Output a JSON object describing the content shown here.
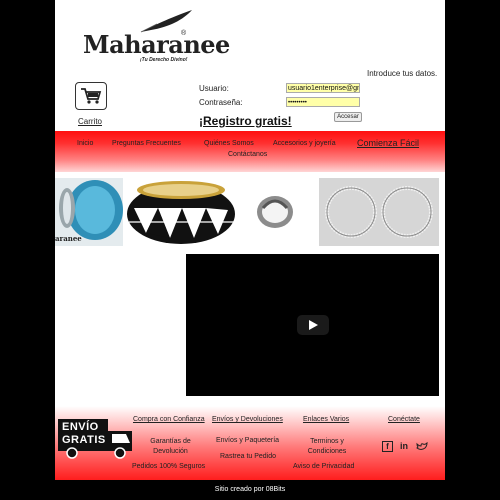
{
  "header": {
    "brand": "Maharanee",
    "registered_mark": "®",
    "tagline": "¡Tu Derecho Divino!",
    "intro": "Introduce tus datos.",
    "cart_label": "Carrito",
    "username_label": "Usuario:",
    "username_value": "usuario1enterprise@gmail",
    "password_label": "Contraseña:",
    "password_value": "•••••••••",
    "login_button": "Accesar",
    "register_link": "¡Registro gratis!"
  },
  "nav": {
    "items": [
      "Inicio",
      "Preguntas Frecuentes",
      "Quiénes Somos",
      "Accesorios y joyería",
      "Contáctanos"
    ],
    "featured": "Comienza Fácil"
  },
  "products": {
    "first_caption": "aranee"
  },
  "footer": {
    "free_shipping_line1": "ENVÍO",
    "free_shipping_line2": "GRATIS",
    "headings": [
      "Compra con Confianza",
      "Envíos y Devoluciones",
      "Enlaces Varios",
      "Conéctate"
    ],
    "links": [
      "Garantías de Devolución",
      "Pedidos 100% Seguros",
      "Envíos y Paquetería",
      "Rastrea tu Pedido",
      "Terminos y Condiciones",
      "Aviso de Privacidad"
    ],
    "social_icons": [
      "facebook-icon",
      "linkedin-icon",
      "twitter-icon"
    ],
    "social_facebook": "f",
    "social_linkedin": "in"
  },
  "credit": "Sitio creado por 08Bits",
  "colors": {
    "nav_red": "#ff1010",
    "field_yellow": "#ffffa8",
    "background": "#000000"
  }
}
